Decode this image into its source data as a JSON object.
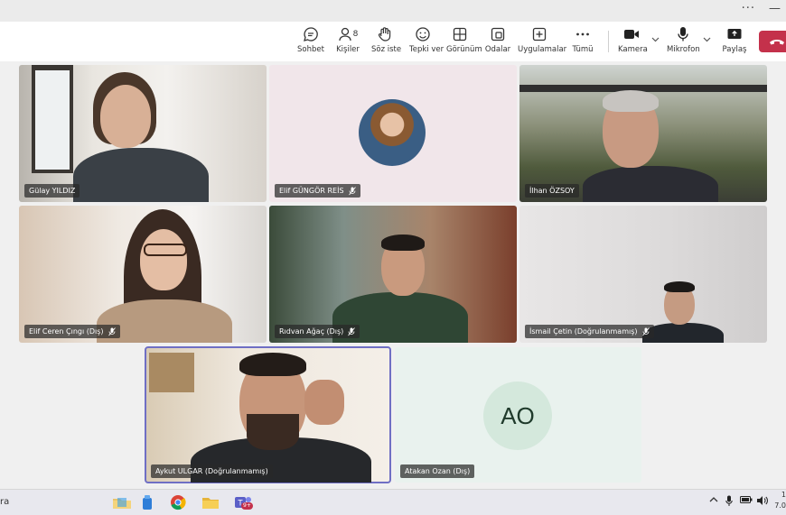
{
  "window": {
    "more_glyph": "···",
    "minimize_glyph": "—"
  },
  "toolbar": {
    "chat": "Sohbet",
    "people": "Kişiler",
    "people_count": "8",
    "raise_hand": "Söz iste",
    "react": "Tepki ver",
    "view": "Görünüm",
    "rooms": "Odalar",
    "apps": "Uygulamalar",
    "more": "Tümü",
    "camera": "Kamera",
    "mic": "Mikrofon",
    "share": "Paylaş"
  },
  "participants": [
    {
      "name": "Gülay YILDIZ",
      "muted": false
    },
    {
      "name": "Elif GÜNGÖR REİS",
      "muted": true
    },
    {
      "name": "İlhan ÖZSOY",
      "muted": false
    },
    {
      "name": "Elif Ceren Çıngı (Dış)",
      "muted": true
    },
    {
      "name": "Rıdvan Ağaç (Dış)",
      "muted": true
    },
    {
      "name": "İsmail Çetin (Doğrulanmamış)",
      "muted": true
    },
    {
      "name": "Aykut ULGAR (Doğrulanmamış)",
      "muted": false
    },
    {
      "name": "Atakan Ozan (Dış)",
      "muted": false,
      "initials": "AO"
    }
  ],
  "taskbar": {
    "search_text": "ra",
    "clock_top": "1",
    "clock_bottom": "7.0",
    "teams_badge": "9+"
  },
  "colors": {
    "hangup": "#c4314b",
    "selected_outline": "#6f6fc4",
    "initials_bg": "#d4e8dc"
  }
}
